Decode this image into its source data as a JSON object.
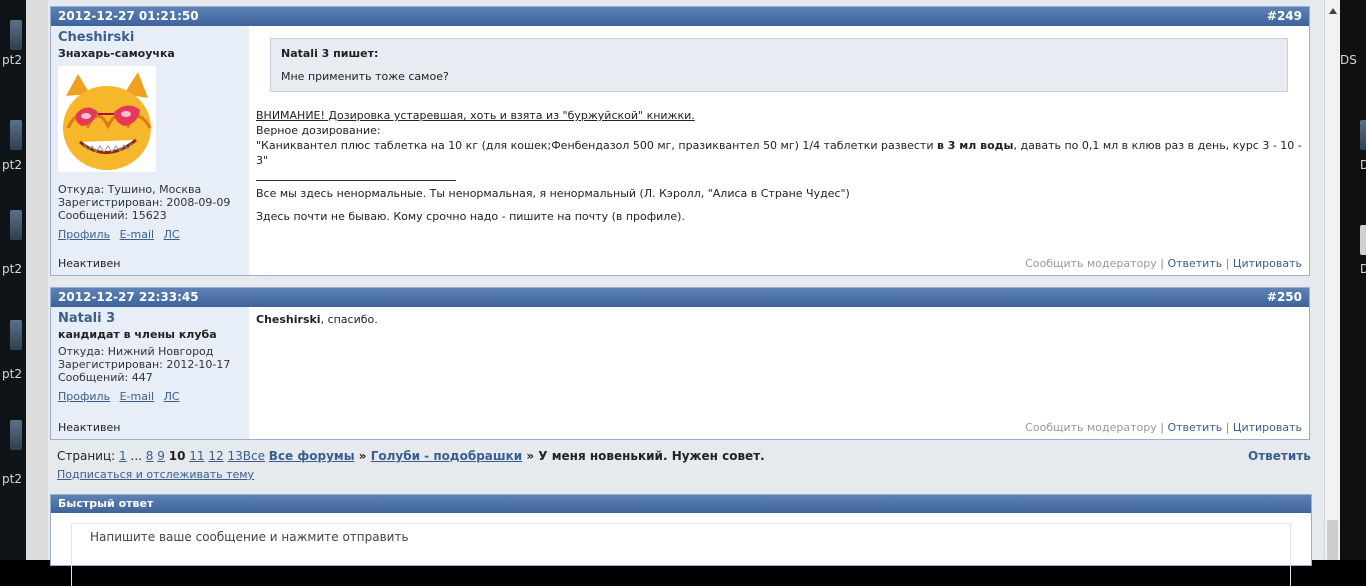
{
  "desktop_left": {
    "labels": [
      "pt2",
      "pt2",
      "pt2",
      "pt2",
      "pt2"
    ]
  },
  "desktop_right": {
    "labels": [
      "DS",
      "D",
      "D"
    ]
  },
  "post1": {
    "datetime": "2012-12-27 01:21:50",
    "number": "#249",
    "author": {
      "name": "Cheshirski",
      "rank": "Знахарь-самоучка",
      "location": "Откуда: Тушино, Москва",
      "registered": "Зарегистрирован: 2008-09-09",
      "messages": "Сообщений: 15623",
      "profile": "Профиль",
      "email": "E-mail",
      "pm": "ЛС",
      "status": "Неактивен"
    },
    "quote_author": "Natali 3 пишет:",
    "quote_text": "Мне применить тоже самое?",
    "line1": "ВНИМАНИЕ! Дозировка устаревшая, хоть и взята из \"буржуйской\" книжки.",
    "line2": "Верное дозирование:",
    "line3a": "\"Каниквантел плюс таблетка на 10 кг (для кошек;Фенбендазол 500 мг, празиквантел 50 мг) 1/4 таблетки развести ",
    "line3b": "в 3 мл воды",
    "line3c": ", давать по 0,1 мл в клюв раз в день, курс 3 - 10 - 3\"",
    "sig1": "Все мы здесь ненормальные. Ты ненормальная, я ненормальный (Л. Кэролл, \"Алиса в Стране Чудес\")",
    "sig2": "Здесь почти не бываю. Кому срочно надо - пишите на почту (в профиле).",
    "report": "Сообщить модератору",
    "reply": "Ответить",
    "quote_btn": "Цитировать"
  },
  "post2": {
    "datetime": "2012-12-27 22:33:45",
    "number": "#250",
    "author": {
      "name": "Natali 3",
      "rank": "кандидат в члены клуба",
      "location": "Откуда: Нижний Новгород",
      "registered": "Зарегистрирован: 2012-10-17",
      "messages": "Сообщений: 447",
      "profile": "Профиль",
      "email": "E-mail",
      "pm": "ЛС",
      "status": "Неактивен"
    },
    "mention": "Cheshirski",
    "text": ", спасибо.",
    "report": "Сообщить модератору",
    "reply": "Ответить",
    "quote_btn": "Цитировать"
  },
  "pager": {
    "label": "Страниц:",
    "p1": "1",
    "dots": "...",
    "p8": "8",
    "p9": "9",
    "current": "10",
    "p11": "11",
    "p12": "12",
    "p13": "13",
    "all": "Все",
    "crumb1": "Все форумы",
    "sep": " » ",
    "crumb2": "Голуби - подобрашки",
    "topic": "У меня новенький. Нужен совет.",
    "reply": "Ответить",
    "subscribe": "Подписаться и отслеживать тему"
  },
  "quick_reply": {
    "title": "Быстрый ответ",
    "placeholder": "Напишите ваше сообщение и нажмите отправить"
  }
}
